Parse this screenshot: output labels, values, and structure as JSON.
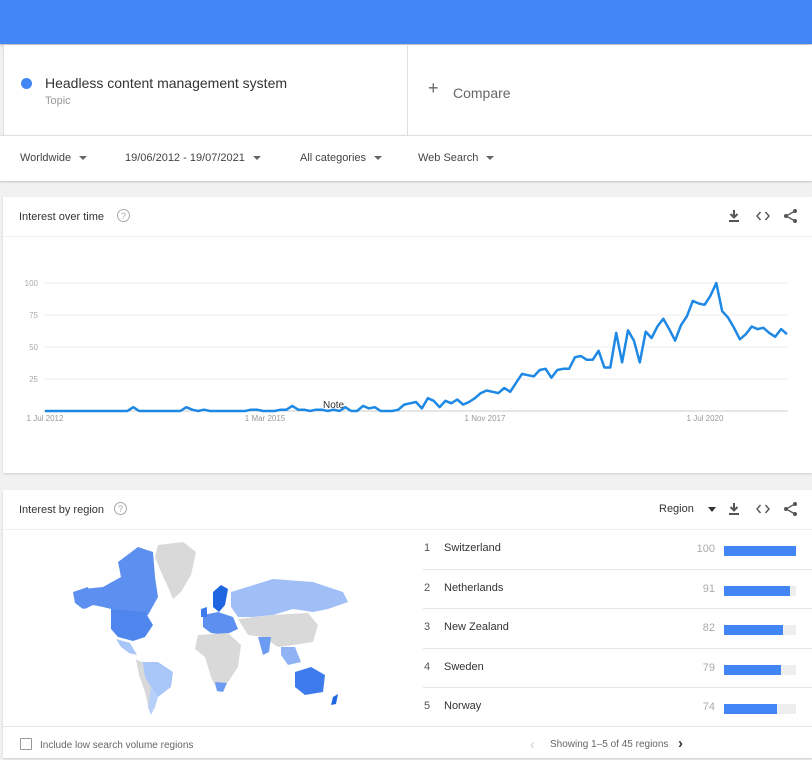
{
  "colors": {
    "brand": "#4285f4",
    "line": "#1e88e5",
    "bar_fill": "#4285f4",
    "bar_track": "#eeeeee"
  },
  "search_term": {
    "name": "Headless content management system",
    "type": "Topic"
  },
  "compare": {
    "icon": "plus-icon",
    "label": "Compare"
  },
  "filters": [
    {
      "label": "Worldwide"
    },
    {
      "label": "19/06/2012 - 19/07/2021"
    },
    {
      "label": "All categories"
    },
    {
      "label": "Web Search"
    }
  ],
  "interest_over_time": {
    "title": "Interest over time",
    "help": "?",
    "tools": [
      "download-icon",
      "embed-icon",
      "share-icon"
    ],
    "note": "Note"
  },
  "chart_data": {
    "type": "line",
    "title": "Interest over time",
    "xlabel": "",
    "ylabel": "",
    "ylim": [
      0,
      100
    ],
    "yticks": [
      25,
      50,
      75,
      100
    ],
    "xticks": [
      "1 Jul 2012",
      "1 Mar 2015",
      "1 Nov 2017",
      "1 Jul 2020"
    ],
    "grid": true,
    "annotation": "Note",
    "series": [
      {
        "name": "Headless content management system",
        "values": [
          0,
          0,
          0,
          0,
          0,
          0,
          0,
          0,
          0,
          0,
          0,
          0,
          0,
          0,
          0,
          3,
          0,
          0,
          0,
          0,
          0,
          0,
          0,
          0,
          3,
          1,
          0,
          1,
          0,
          0,
          0,
          0,
          0,
          0,
          0,
          1,
          1,
          0,
          0,
          0,
          1,
          1,
          4,
          1,
          1,
          0,
          1,
          1,
          0,
          1,
          0,
          3,
          0,
          0,
          4,
          2,
          3,
          0,
          0,
          0,
          1,
          5,
          6,
          7,
          2,
          10,
          8,
          3,
          8,
          6,
          9,
          5,
          7,
          10,
          14,
          16,
          15,
          14,
          18,
          15,
          22,
          29,
          28,
          27,
          32,
          33,
          26,
          32,
          33,
          33,
          42,
          43,
          40,
          40,
          47,
          34,
          34,
          61,
          38,
          63,
          55,
          38,
          62,
          57,
          66,
          72,
          64,
          55,
          67,
          74,
          86,
          84,
          83,
          90,
          100,
          78,
          73,
          65,
          56,
          60,
          66,
          64,
          65,
          61,
          58,
          64,
          60
        ]
      }
    ]
  },
  "interest_by_region": {
    "title": "Interest by region",
    "help": "?",
    "region_select": "Region",
    "tools": [
      "download-icon",
      "embed-icon",
      "share-icon"
    ],
    "rows": [
      {
        "rank": "1",
        "name": "Switzerland",
        "value": 100
      },
      {
        "rank": "2",
        "name": "Netherlands",
        "value": 91
      },
      {
        "rank": "3",
        "name": "New Zealand",
        "value": 82
      },
      {
        "rank": "4",
        "name": "Sweden",
        "value": 79
      },
      {
        "rank": "5",
        "name": "Norway",
        "value": 74
      }
    ],
    "include_low_volume_label": "Include low search volume regions",
    "include_low_volume_checked": false,
    "pagination": "Showing 1–5 of 45 regions"
  }
}
